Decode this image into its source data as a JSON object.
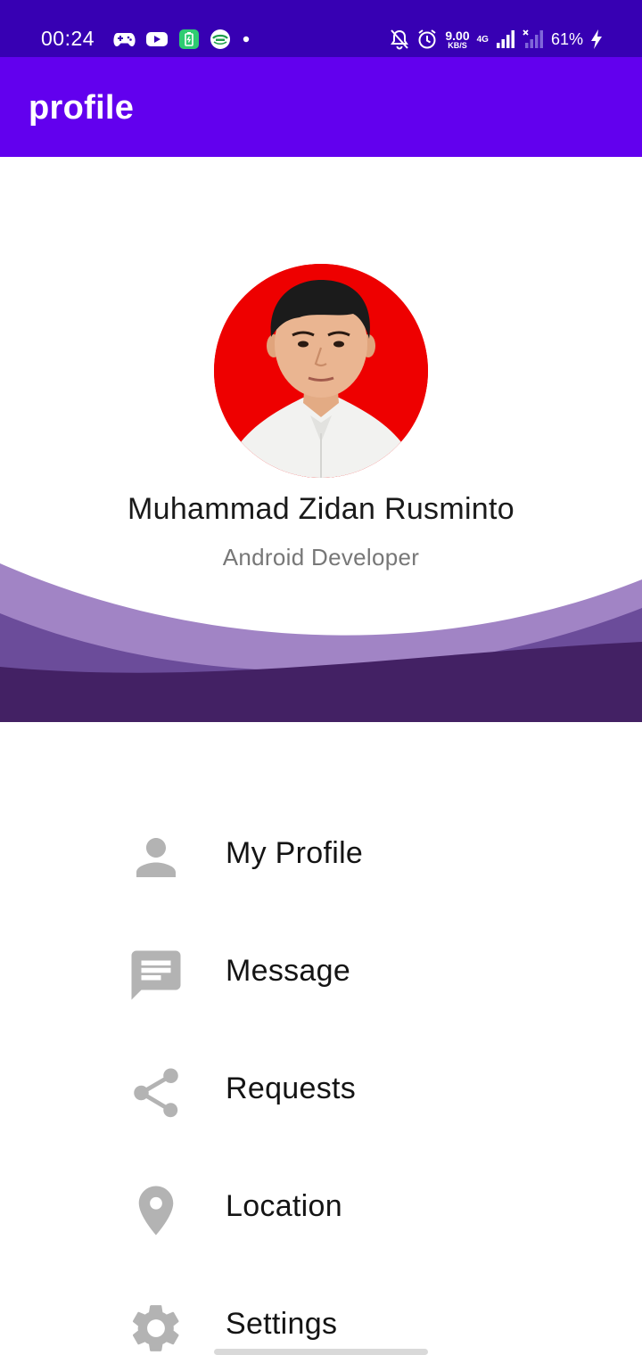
{
  "status_bar": {
    "time": "00:24",
    "left_icons": [
      "gamepad-icon",
      "youtube-icon",
      "battery-app-icon",
      "globe-app-icon",
      "dot-icon"
    ],
    "network_speed_value": "9.00",
    "network_speed_unit": "KB/S",
    "network_type": "4G",
    "battery_percent": "61%",
    "background_color": "#3700b3"
  },
  "app_bar": {
    "title": "profile",
    "background_color": "#6200ee"
  },
  "profile": {
    "name": "Muhammad Zidan Rusminto",
    "role": "Android Developer",
    "avatar_background": "#ee0000"
  },
  "wave_colors": [
    "#a184c5",
    "#6b4c9a",
    "#432164"
  ],
  "menu": {
    "items": [
      {
        "label": "My Profile",
        "icon": "person-icon"
      },
      {
        "label": "Message",
        "icon": "message-icon"
      },
      {
        "label": "Requests",
        "icon": "share-icon"
      },
      {
        "label": "Location",
        "icon": "location-pin-icon"
      },
      {
        "label": "Settings",
        "icon": "gear-icon"
      }
    ],
    "icon_color": "#b3b3b3"
  }
}
